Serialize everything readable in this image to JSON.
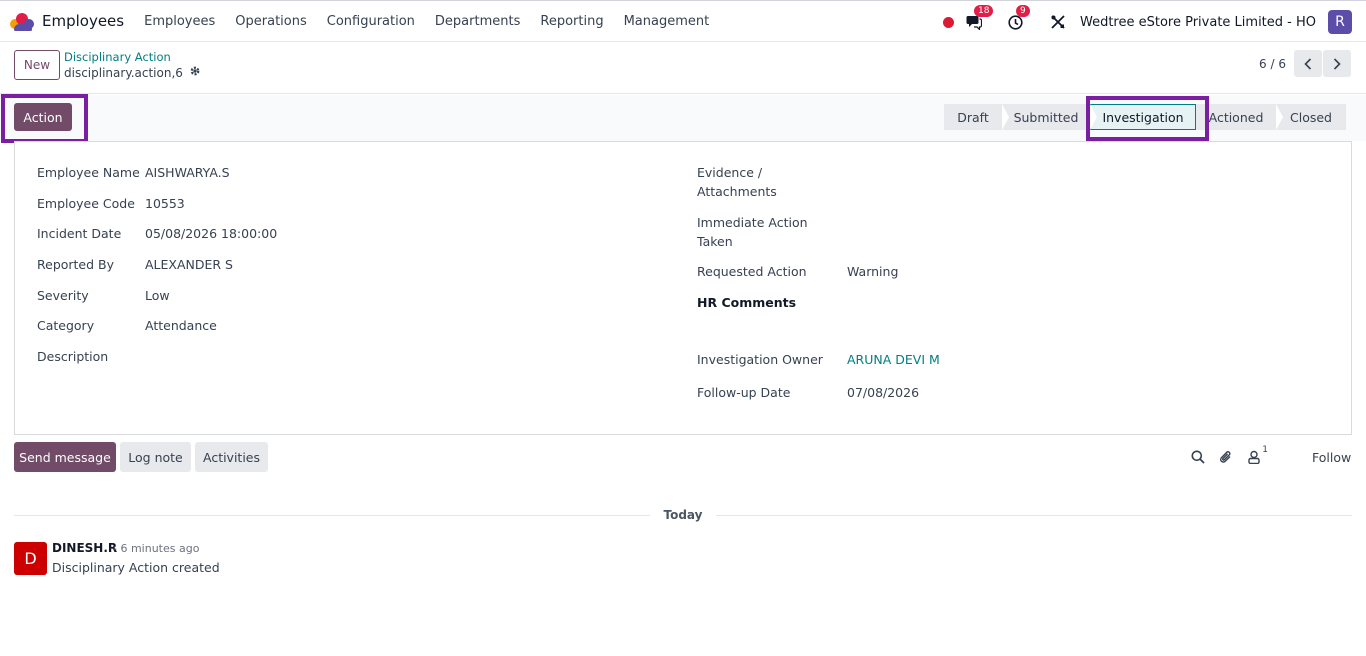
{
  "navbar": {
    "app_name": "Employees",
    "menu": [
      "Employees",
      "Operations",
      "Configuration",
      "Departments",
      "Reporting",
      "Management"
    ],
    "messages_badge": "18",
    "activities_badge": "9",
    "company": "Wedtree eStore Private Limited - HO",
    "user_initial": "R"
  },
  "control": {
    "new_label": "New",
    "breadcrumb_parent": "Disciplinary Action",
    "breadcrumb_current": "disciplinary.action,6",
    "pager": "6 / 6"
  },
  "statusbar": {
    "action_label": "Action",
    "stages": [
      "Draft",
      "Submitted",
      "Investigation",
      "Actioned",
      "Closed"
    ],
    "active_stage": "Investigation"
  },
  "form": {
    "left": [
      {
        "label": "Employee Name",
        "value": "AISHWARYA.S"
      },
      {
        "label": "Employee Code",
        "value": "10553"
      },
      {
        "label": "Incident Date",
        "value": "05/08/2026 18:00:00"
      },
      {
        "label": "Reported By",
        "value": "ALEXANDER S"
      },
      {
        "label": "Severity",
        "value": "Low"
      },
      {
        "label": "Category",
        "value": "Attendance"
      },
      {
        "label": "Description",
        "value": ""
      }
    ],
    "right": {
      "evidence_label_1": "Evidence /",
      "evidence_label_2": "Attachments",
      "immediate_label_1": "Immediate Action",
      "immediate_label_2": "Taken",
      "requested_label": "Requested Action",
      "requested_value": "Warning",
      "hr_comments": "HR Comments",
      "owner_label": "Investigation Owner",
      "owner_value": "ARUNA DEVI M",
      "followup_label": "Follow-up Date",
      "followup_value": "07/08/2026"
    }
  },
  "chatter": {
    "send_label": "Send message",
    "log_label": "Log note",
    "activities_label": "Activities",
    "follower_count": "1",
    "follow_label": "Follow",
    "today_label": "Today",
    "message": {
      "avatar_initial": "D",
      "author": "DINESH.R",
      "time": "- 6 minutes ago",
      "body": "Disciplinary Action created"
    }
  },
  "colors": {
    "primary": "#714b67",
    "link": "#017e84",
    "highlight": "#7b1fa2",
    "badge": "#e11d48"
  }
}
